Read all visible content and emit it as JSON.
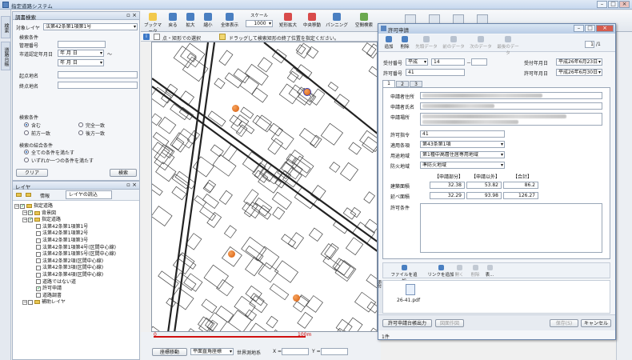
{
  "app": {
    "title": "指定道路システム"
  },
  "vtabs": [
    "検索",
    "道路台帳"
  ],
  "search": {
    "panel_title": "調書検索",
    "target_layer_label": "対象レイヤ",
    "target_layer_value": "法第42条第1項第1号",
    "cond_label": "検索条件",
    "mgmt_no_label": "管理番号",
    "date_label": "市道認定年月日",
    "date_from": "年 月 日",
    "date_to": "年 月 日",
    "tilde": "～",
    "start_label": "起点地名",
    "end_label": "終点地名",
    "search_cond_title": "検索条件",
    "r_contains": "含む",
    "r_exact": "完全一致",
    "r_prefix": "前方一致",
    "r_suffix": "後方一致",
    "combine_title": "検索の結合条件",
    "r_all": "全ての条件を満たす",
    "r_any": "いずれか一つの条件を満たす",
    "clear_btn": "クリア",
    "search_btn": "検索"
  },
  "layers": {
    "panel_title": "レイヤ",
    "info_btn": "情報",
    "load_btn": "レイヤの読込",
    "tree": [
      {
        "label": "指定道路",
        "indent": 0,
        "checked": true
      },
      {
        "label": "背景図",
        "indent": 1,
        "checked": true
      },
      {
        "label": "指定道路",
        "indent": 1,
        "checked": true
      },
      {
        "label": "法第42条第1項第1号",
        "indent": 2,
        "checked": false
      },
      {
        "label": "法第42条第1項第2号",
        "indent": 2,
        "checked": false
      },
      {
        "label": "法第42条第1項第3号",
        "indent": 2,
        "checked": false
      },
      {
        "label": "法第42条第1項第4号(区間中心線)",
        "indent": 2,
        "checked": false
      },
      {
        "label": "法第42条第1項第5号(区間中心線)",
        "indent": 2,
        "checked": false
      },
      {
        "label": "法第42条第2項(区間中心線)",
        "indent": 2,
        "checked": false
      },
      {
        "label": "法第42条第3項(区間中心線)",
        "indent": 2,
        "checked": false
      },
      {
        "label": "法第42条第4項(区間中心線)",
        "indent": 2,
        "checked": false
      },
      {
        "label": "道路ではない道",
        "indent": 2,
        "checked": false
      },
      {
        "label": "許可申請",
        "indent": 2,
        "checked": true
      },
      {
        "label": "道路調書",
        "indent": 2,
        "checked": false
      },
      {
        "label": "補助レイヤ",
        "indent": 1,
        "checked": false
      }
    ]
  },
  "toolbar": {
    "items": [
      "ブックマーク",
      "戻る",
      "拡大",
      "縮小",
      "全体表示",
      "スケール",
      "矩形拡大",
      "中央移動",
      "パンニング",
      "空間検索"
    ],
    "scale_value": "1000"
  },
  "hint": {
    "mode": "点・矩形での選択",
    "message": "ドラッグして検索矩形の終了位置を指定ください。"
  },
  "mapfoot": {
    "scale_start": "0",
    "scale_end": "100m",
    "coord_btn": "座標移動",
    "crs_value": "平面直角座標",
    "geodetic_label": "世界測地系",
    "x_label": "X =",
    "y_label": "Y ="
  },
  "dialog": {
    "title": "許可申請",
    "tools": [
      "追加",
      "削除",
      "先頭データ",
      "前のデータ",
      "次のデータ",
      "最後のデータ"
    ],
    "page_value": "1",
    "page_total": "/1",
    "accept_no_label": "受付番号",
    "era_value": "平成",
    "accept_no_1": "14",
    "accept_no_dash": "－",
    "accept_date_label": "受付年月日",
    "accept_date_value": "平成26年6月23日",
    "permit_no_label": "許可番号",
    "permit_no_value": "41",
    "permit_date_label": "許可年月日",
    "permit_date_value": "平成26年6月30日",
    "tabs": [
      "1",
      "2",
      "3"
    ],
    "applicant_addr_label": "申請者住所",
    "applicant_name_label": "申請者氏名",
    "applicant_place_label": "申請場所",
    "permit_index_label": "許可指令",
    "permit_index_value": "41",
    "law_label": "適用条項",
    "law_value": "第43条第1項",
    "use_label": "用途地域",
    "use_value": "第1種中高層住居専用地域",
    "fire_label": "防火地域",
    "fire_value": "準防火地域",
    "grid_headers": [
      "【申請部分】",
      "【申請以外】",
      "【合計】"
    ],
    "building_area_label": "建築面積",
    "building_area": [
      "32.38",
      "53.82",
      "86.2"
    ],
    "floor_area_label": "延べ面積",
    "floor_area": [
      "32.29",
      "93.98",
      "126.27"
    ],
    "condition_label": "許可条件",
    "attach_tools": [
      "ファイルを追加",
      "リンクを追加",
      "開く",
      "削除",
      "表..."
    ],
    "attach_side_label": "添付",
    "attach_file": "26-41.pdf",
    "btn_ledger": "許可申請台帳出力",
    "btn_print": "図面作図",
    "btn_save": "保存(S)",
    "btn_cancel": "キャンセル",
    "status": "1件"
  }
}
